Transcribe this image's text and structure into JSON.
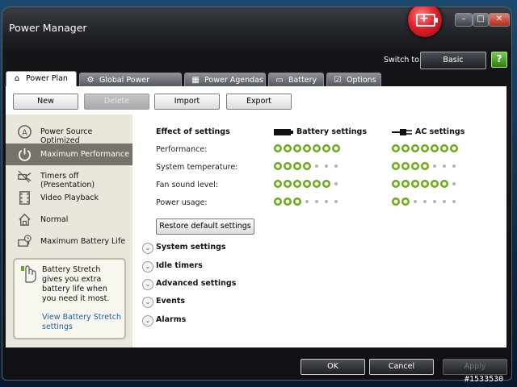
{
  "window": {
    "title": "Power Manager"
  },
  "titlebar": {
    "minimize": "–",
    "maximize": "□",
    "close": "✕"
  },
  "header": {
    "switch_label": "Switch to:",
    "switch_button": "Basic",
    "help": "?"
  },
  "tabs": [
    {
      "label": "Power Plan",
      "icon": "house-icon",
      "active": true
    },
    {
      "label": "Global Power Settings",
      "icon": "gear-icon"
    },
    {
      "label": "Power Agendas",
      "icon": "calendar-icon"
    },
    {
      "label": "Battery",
      "icon": "battery-icon"
    },
    {
      "label": "Options",
      "icon": "checkbox-icon"
    }
  ],
  "toolbar": {
    "new": "New",
    "delete": "Delete",
    "import": "Import",
    "export": "Export"
  },
  "plans": [
    {
      "label": "Power Source Optimized",
      "icon": "auto-source-icon"
    },
    {
      "label": "Maximum Performance",
      "icon": "power-icon",
      "selected": true
    },
    {
      "label": "Timers off (Presentation)",
      "icon": "projector-icon"
    },
    {
      "label": "Video Playback",
      "icon": "film-icon"
    },
    {
      "label": "Normal",
      "icon": "house-icon"
    },
    {
      "label": "Maximum Battery Life",
      "icon": "battery-clock-icon"
    }
  ],
  "tip": {
    "text": "Battery Stretch gives you extra battery life when you need it most.",
    "link": "View Battery Stretch settings"
  },
  "effects": {
    "heading": "Effect of settings",
    "battery_heading": "Battery settings",
    "ac_heading": "AC settings",
    "rows": [
      {
        "label": "Performance:",
        "battery": 7,
        "ac": 7
      },
      {
        "label": "System temperature:",
        "battery": 4,
        "ac": 4
      },
      {
        "label": "Fan sound level:",
        "battery": 6,
        "ac": 6
      },
      {
        "label": "Power usage:",
        "battery": 3,
        "ac": 2
      }
    ],
    "max_level": 7,
    "restore_button": "Restore default settings"
  },
  "sections": [
    "System settings",
    "Idle timers",
    "Advanced settings",
    "Events",
    "Alarms"
  ],
  "footer": {
    "ok": "OK",
    "cancel": "Cancel",
    "apply": "Apply"
  },
  "stamp": "#1533530"
}
